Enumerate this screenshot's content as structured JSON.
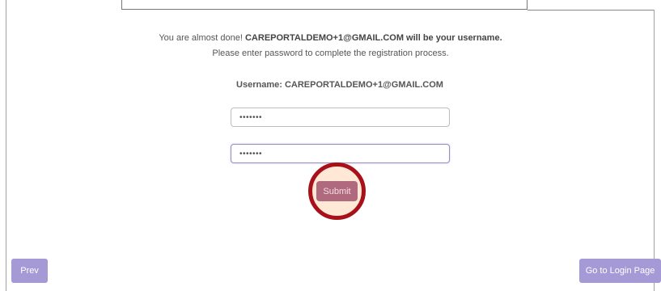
{
  "registration": {
    "msg_prefix": "You are almost done! ",
    "msg_email": "CAREPORTALDEMO+1@GMAIL.COM",
    "msg_suffix": " will be your username.",
    "msg_line2": "Please enter password to complete the registration process.",
    "username_label": "Username: CAREPORTALDEMO+1@GMAIL.COM",
    "password_value": "•••••••",
    "confirm_password_value": "•••••••",
    "submit_label": "Submit"
  },
  "footer": {
    "prev_label": "Prev",
    "login_label": "Go to Login Page"
  },
  "colors": {
    "nav_button": "#a59ad6",
    "submit_button": "#b06a7e",
    "highlight_ring": "#a8101a"
  }
}
